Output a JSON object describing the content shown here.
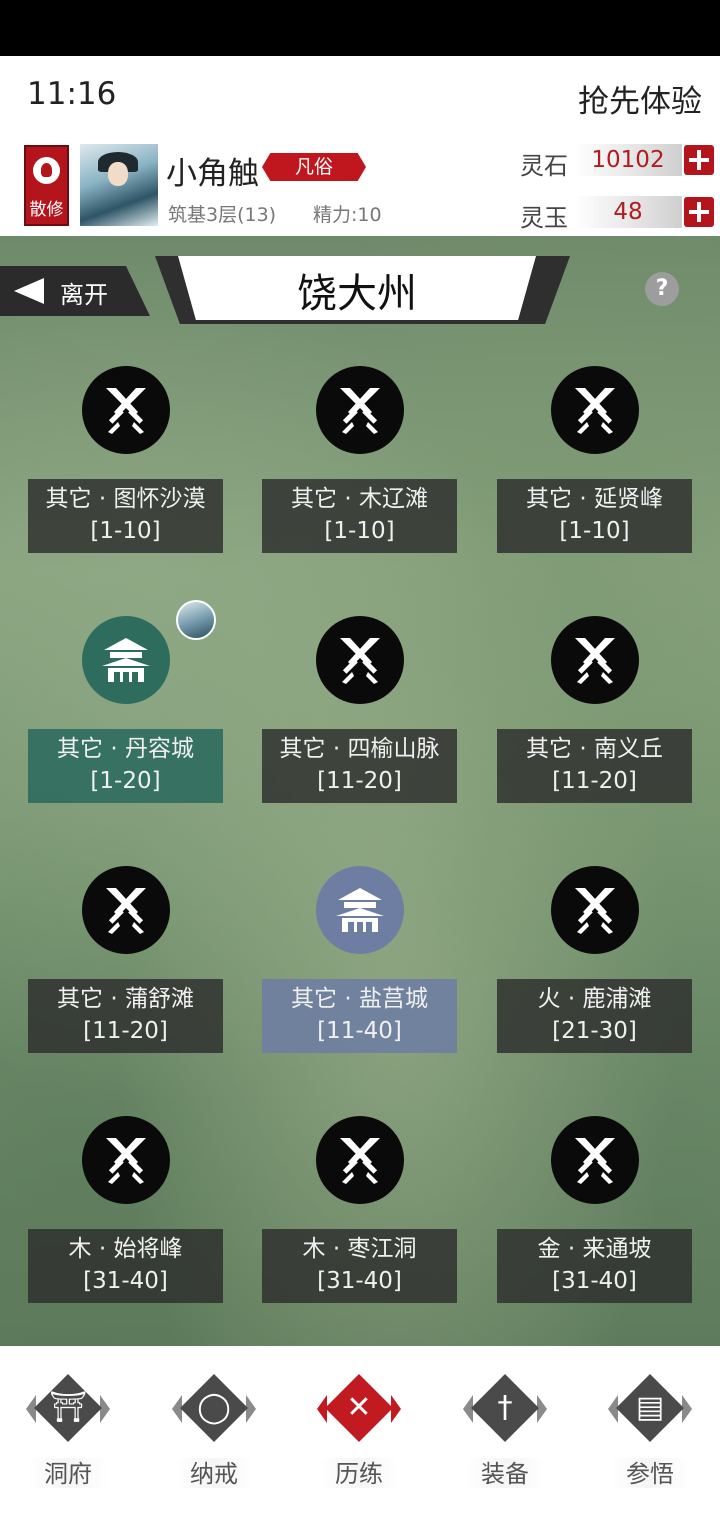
{
  "status": {
    "time": "11:16",
    "early_access": "抢先体验"
  },
  "profile": {
    "sect": "散修",
    "name": "小角触",
    "rank": "凡俗",
    "realm": "筑基3层(13)",
    "stamina": "精力:10",
    "currencies": [
      {
        "label": "灵石",
        "value": "10102"
      },
      {
        "label": "灵玉",
        "value": "48"
      }
    ]
  },
  "map": {
    "leave_label": "离开",
    "title": "饶大州",
    "help": "?",
    "nodes": [
      {
        "name": "其它 · 图怀沙漠",
        "range": "[1-10]",
        "type": "battle"
      },
      {
        "name": "其它 · 木辽滩",
        "range": "[1-10]",
        "type": "battle"
      },
      {
        "name": "其它 · 延贤峰",
        "range": "[1-10]",
        "type": "battle"
      },
      {
        "name": "其它 · 丹容城",
        "range": "[1-20]",
        "type": "city-green"
      },
      {
        "name": "其它 · 四榆山脉",
        "range": "[11-20]",
        "type": "battle"
      },
      {
        "name": "其它 · 南义丘",
        "range": "[11-20]",
        "type": "battle"
      },
      {
        "name": "其它 · 蒲舒滩",
        "range": "[11-20]",
        "type": "battle"
      },
      {
        "name": "其它 · 盐莒城",
        "range": "[11-40]",
        "type": "city-blue"
      },
      {
        "name": "火 · 鹿浦滩",
        "range": "[21-30]",
        "type": "battle"
      },
      {
        "name": "木 · 始将峰",
        "range": "[31-40]",
        "type": "battle"
      },
      {
        "name": "木 · 枣江洞",
        "range": "[31-40]",
        "type": "battle"
      },
      {
        "name": "金 · 来通坡",
        "range": "[31-40]",
        "type": "battle"
      }
    ]
  },
  "nav": [
    {
      "label": "洞府",
      "icon": "gate-icon",
      "active": false
    },
    {
      "label": "纳戒",
      "icon": "ring-icon",
      "active": false
    },
    {
      "label": "历练",
      "icon": "crossed-swords-icon",
      "active": true
    },
    {
      "label": "装备",
      "icon": "sword-icon",
      "active": false
    },
    {
      "label": "参悟",
      "icon": "book-icon",
      "active": false
    }
  ]
}
